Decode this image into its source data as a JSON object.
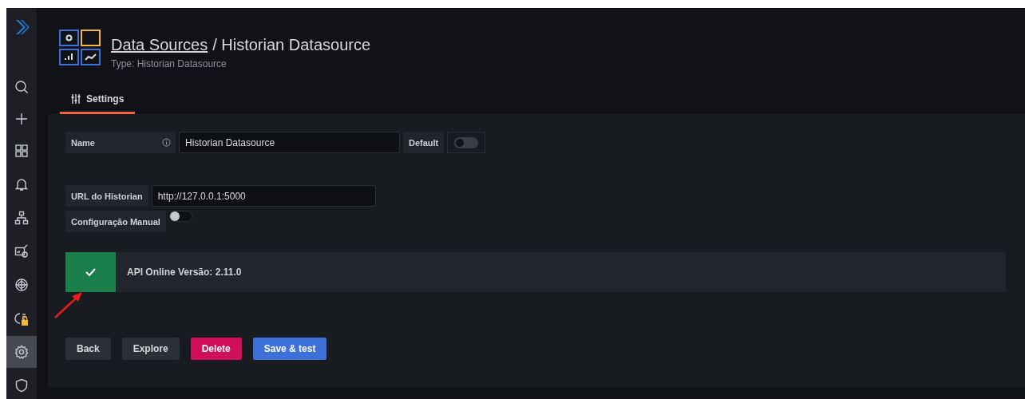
{
  "sidebar": {
    "items": [
      {
        "kind": "search",
        "selected": false
      },
      {
        "kind": "plus",
        "selected": false
      },
      {
        "kind": "grid",
        "selected": false
      },
      {
        "kind": "bell",
        "selected": false
      },
      {
        "kind": "hierarchy",
        "selected": false
      },
      {
        "kind": "chart",
        "selected": false
      },
      {
        "kind": "target",
        "selected": false
      },
      {
        "kind": "lock",
        "selected": false
      },
      {
        "kind": "gear",
        "selected": true
      },
      {
        "kind": "shield",
        "selected": false
      }
    ]
  },
  "header": {
    "breadcrumb_link": "Data Sources",
    "title": "/ Historian Datasource",
    "subtitle": "Type: Historian Datasource"
  },
  "tabs": [
    {
      "label": "Settings",
      "selected": true
    }
  ],
  "form": {
    "name_label": "Name",
    "name_value": "Historian Datasource",
    "default_label": "Default",
    "default_on": false,
    "url_label": "URL do Historian",
    "url_value": "http://127.0.0.1:5000",
    "manual_label": "Configuração Manual",
    "manual_on": false
  },
  "alert": {
    "kind": "success",
    "message": "API Online Versão: 2.11.0"
  },
  "buttons": [
    {
      "label": "Back",
      "kind": "secondary"
    },
    {
      "label": "Explore",
      "kind": "secondary"
    },
    {
      "label": "Delete",
      "kind": "danger"
    },
    {
      "label": "Save & test",
      "kind": "primary"
    }
  ]
}
